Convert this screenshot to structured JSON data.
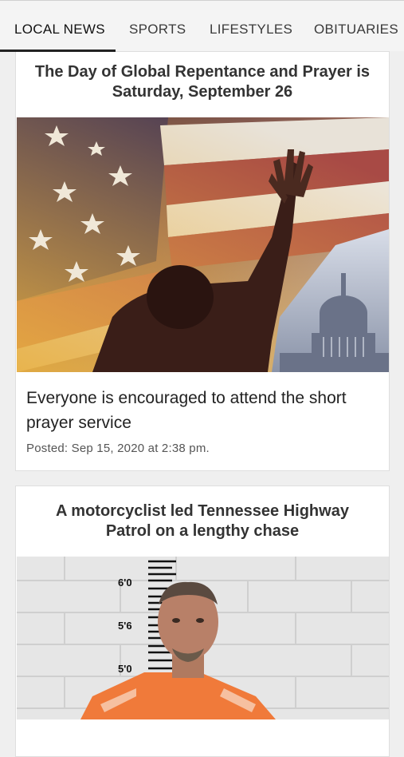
{
  "tabs": [
    {
      "label": "LOCAL NEWS",
      "active": true
    },
    {
      "label": "SPORTS",
      "active": false
    },
    {
      "label": "LIFESTYLES",
      "active": false
    },
    {
      "label": "OBITUARIES",
      "active": false
    }
  ],
  "articles": [
    {
      "title": "The Day of Global Repentance and Prayer is Saturday, September 26",
      "image": "flag-prayer-capitol-photo",
      "summary": "Everyone is encouraged to attend the short prayer service",
      "posted": "Posted: Sep 15, 2020 at 2:38 pm."
    },
    {
      "title": "A motorcyclist led Tennessee Highway Patrol on a lengthy chase",
      "image": "mugshot-photo",
      "height_marks": [
        "6'0",
        "5'6",
        "5'0"
      ]
    }
  ],
  "colors": {
    "accent": "#222222",
    "inmate_uniform": "#f07a3a"
  }
}
